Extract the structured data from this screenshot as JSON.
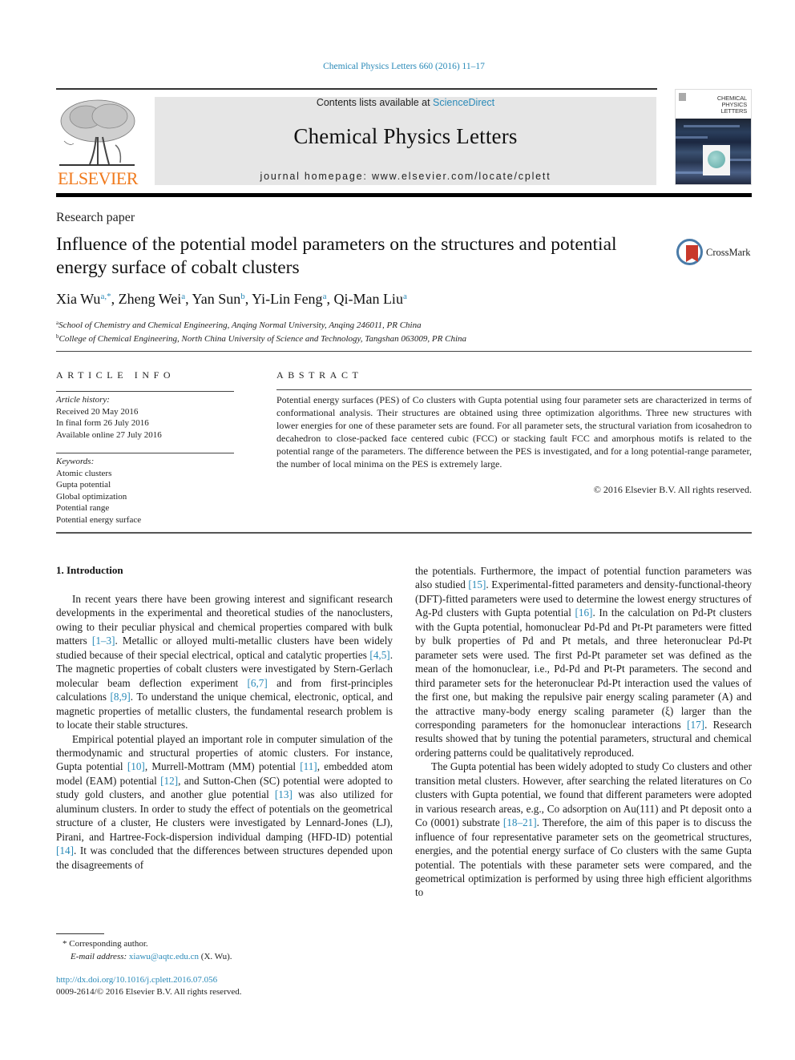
{
  "header": {
    "journal_reference": "Chemical Physics Letters 660 (2016) 11–17",
    "contents_prefix": "Contents lists available at ",
    "contents_link": "ScienceDirect",
    "journal_name": "Chemical Physics Letters",
    "homepage_label": "journal homepage: www.elsevier.com/locate/cplett",
    "publisher_logo_text": "ELSEVIER",
    "cover_title_lines": [
      "CHEMICAL",
      "PHYSICS",
      "LETTERS"
    ],
    "brand_color": "#f07a1d",
    "link_color": "#2a8ab8"
  },
  "article": {
    "type": "Research paper",
    "title": "Influence of the potential model parameters on the structures and potential energy surface of cobalt clusters",
    "crossmark_label": "CrossMark",
    "authors": [
      {
        "name": "Xia Wu",
        "sup": "a,*"
      },
      {
        "name": "Zheng Wei",
        "sup": "a"
      },
      {
        "name": "Yan Sun",
        "sup": "b"
      },
      {
        "name": "Yi-Lin Feng",
        "sup": "a"
      },
      {
        "name": "Qi-Man Liu",
        "sup": "a"
      }
    ],
    "affiliations": [
      {
        "key": "a",
        "text": "School of Chemistry and Chemical Engineering, Anqing Normal University, Anqing 246011, PR China"
      },
      {
        "key": "b",
        "text": "College of Chemical Engineering, North China University of Science and Technology, Tangshan 063009, PR China"
      }
    ]
  },
  "article_info": {
    "heading": "ARTICLE INFO",
    "history_label": "Article history:",
    "history": [
      "Received 20 May 2016",
      "In final form 26 July 2016",
      "Available online 27 July 2016"
    ],
    "keywords_label": "Keywords:",
    "keywords": [
      "Atomic clusters",
      "Gupta potential",
      "Global optimization",
      "Potential range",
      "Potential energy surface"
    ]
  },
  "abstract": {
    "heading": "ABSTRACT",
    "text": "Potential energy surfaces (PES) of Co clusters with Gupta potential using four parameter sets are characterized in terms of conformational analysis. Their structures are obtained using three optimization algorithms. Three new structures with lower energies for one of these parameter sets are found. For all parameter sets, the structural variation from icosahedron to decahedron to close-packed face centered cubic (FCC) or stacking fault FCC and amorphous motifs is related to the potential range of the parameters. The difference between the PES is investigated, and for a long potential-range parameter, the number of local minima on the PES is extremely large.",
    "copyright": "© 2016 Elsevier B.V. All rights reserved."
  },
  "introduction": {
    "heading": "1. Introduction",
    "left_p1": [
      {
        "t": "In recent years there have been growing interest and significant research developments in the experimental and theoretical studies of the nanoclusters, owing to their peculiar physical and chemical properties compared with bulk matters "
      },
      {
        "c": "[1–3]"
      },
      {
        "t": ". Metallic or alloyed multi-metallic clusters have been widely studied because of their special electrical, optical and catalytic properties "
      },
      {
        "c": "[4,5]"
      },
      {
        "t": ". The magnetic properties of cobalt clusters were investigated by Stern-Gerlach molecular beam deflection experiment "
      },
      {
        "c": "[6,7]"
      },
      {
        "t": " and from first-principles calculations "
      },
      {
        "c": "[8,9]"
      },
      {
        "t": ". To understand the unique chemical, electronic, optical, and magnetic properties of metallic clusters, the fundamental research problem is to locate their stable structures."
      }
    ],
    "left_p2": [
      {
        "t": "Empirical potential played an important role in computer simulation of the thermodynamic and structural properties of atomic clusters. For instance, Gupta potential "
      },
      {
        "c": "[10]"
      },
      {
        "t": ", Murrell-Mottram (MM) potential "
      },
      {
        "c": "[11]"
      },
      {
        "t": ", embedded atom model (EAM) potential "
      },
      {
        "c": "[12]"
      },
      {
        "t": ", and Sutton-Chen (SC) potential were adopted to study gold clusters, and another glue potential "
      },
      {
        "c": "[13]"
      },
      {
        "t": " was also utilized for aluminum clusters. In order to study the effect of potentials on the geometrical structure of a cluster, He clusters were investigated by Lennard-Jones (LJ), Pirani, and Hartree-Fock-dispersion individual damping (HFD-ID) potential "
      },
      {
        "c": "[14]"
      },
      {
        "t": ". It was concluded that the differences between structures depended upon the disagreements of"
      }
    ],
    "right_p1": [
      {
        "t": "the potentials. Furthermore, the impact of potential function parameters was also studied "
      },
      {
        "c": "[15]"
      },
      {
        "t": ". Experimental-fitted parameters and density-functional-theory (DFT)-fitted parameters were used to determine the lowest energy structures of Ag-Pd clusters with Gupta potential "
      },
      {
        "c": "[16]"
      },
      {
        "t": ". In the calculation on Pd-Pt clusters with the Gupta potential, homonuclear Pd-Pd and Pt-Pt parameters were fitted by bulk properties of Pd and Pt metals, and three heteronuclear Pd-Pt parameter sets were used. The first Pd-Pt parameter set was defined as the mean of the homonuclear, i.e., Pd-Pd and Pt-Pt parameters. The second and third parameter sets for the heteronuclear Pd-Pt interaction used the values of the first one, but making the repulsive pair energy scaling parameter (A) and the attractive many-body energy scaling parameter (ξ) larger than the corresponding parameters for the homonuclear interactions "
      },
      {
        "c": "[17]"
      },
      {
        "t": ". Research results showed that by tuning the potential parameters, structural and chemical ordering patterns could be qualitatively reproduced."
      }
    ],
    "right_p2": [
      {
        "t": "The Gupta potential has been widely adopted to study Co clusters and other transition metal clusters. However, after searching the related literatures on Co clusters with Gupta potential, we found that different parameters were adopted in various research areas, e.g., Co adsorption on Au(111) and Pt deposit onto a Co (0001) substrate "
      },
      {
        "c": "[18–21]"
      },
      {
        "t": ". Therefore, the aim of this paper is to discuss the influence of four representative parameter sets on the geometrical structures, energies, and the potential energy surface of Co clusters with the same Gupta potential. The potentials with these parameter sets were compared, and the geometrical optimization is performed by using three high efficient algorithms to"
      }
    ]
  },
  "footnotes": {
    "star": "*",
    "corresponding": "Corresponding author.",
    "email_label": "E-mail address: ",
    "email": "xiawu@aqtc.edu.cn",
    "email_suffix": " (X. Wu).",
    "doi": "http://dx.doi.org/10.1016/j.cplett.2016.07.056",
    "issn_copyright": "0009-2614/© 2016 Elsevier B.V. All rights reserved."
  }
}
